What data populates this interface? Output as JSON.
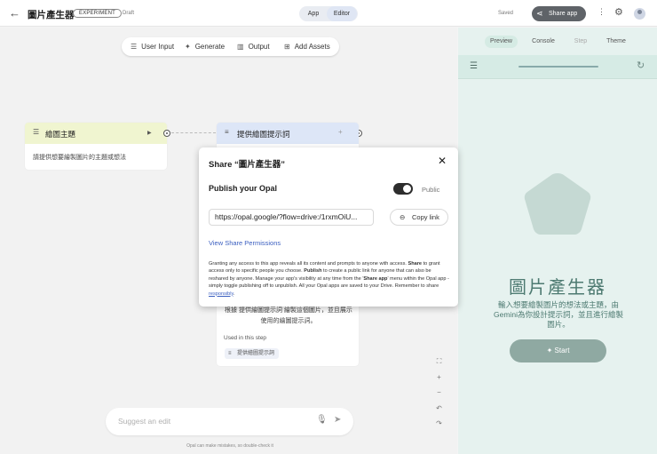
{
  "topbar": {
    "back_icon": "arrow-left-icon",
    "title": "圖片產生器",
    "badge": "EXPERIMENT",
    "status": "Draft",
    "mode_app": "App",
    "mode_editor": "Editor",
    "saved": "Saved",
    "share_label": "Share app"
  },
  "toolbar": {
    "user_input": "User Input",
    "generate": "Generate",
    "output": "Output",
    "add_assets": "Add Assets"
  },
  "node1": {
    "title": "繪圖主題",
    "body": "請提供想要繪製圖片的主題或想法"
  },
  "node2": {
    "title": "提供繪圖提示詞",
    "text": "根據 提供繪圖提示詞 繪製這個圖片，並且展示使用的繪圖提示詞。",
    "used_label": "Used in this step",
    "chip": "提供繪圖提示詞"
  },
  "suggest": {
    "placeholder": "Suggest an edit"
  },
  "disclaimer": "Opal can make mistakes, so double-check it",
  "dialog": {
    "title": "Share “圖片產生器”",
    "publish_label": "Publish your Opal",
    "public_label": "Public",
    "publish_on": true,
    "url": "https://opal.google/?flow=drive:/1rxmOiU...",
    "copy_label": "Copy link",
    "permissions_link": "View Share Permissions",
    "p1": "Granting any access to this app reveals all its content and prompts to anyone with access.",
    "p2_bold": "Share",
    "p2": " to grant access only to specific people you choose. ",
    "p3_bold": "Publish",
    "p3": " to create a public link for anyone that can also be reshared by anyone. Manage your app's visibility at any time from the '",
    "p4_bold": "Share app",
    "p4": "' menu within the Opal app - simply toggle publishing off to unpublish. All your Opal apps are saved to your Drive. Remember to share ",
    "p5_link": "responsibly",
    "p6": "."
  },
  "preview": {
    "tabs": [
      "Preview",
      "Console",
      "Step",
      "Theme"
    ],
    "title": "圖片產生器",
    "description": "輸入想要繪製圖片的想法或主題，由Gemini為你設計提示詞，並且進行繪製圖片。",
    "start_label": "Start",
    "progress": 0,
    "accent": "#4d7a71"
  }
}
